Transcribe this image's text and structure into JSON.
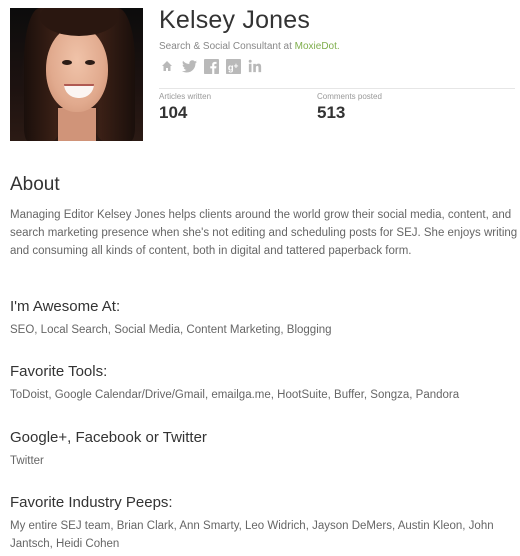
{
  "profile": {
    "name": "Kelsey Jones",
    "title_prefix": "Search & Social Consultant at ",
    "company": "MoxieDot."
  },
  "social_icons": [
    "home-icon",
    "twitter-icon",
    "facebook-icon",
    "google-plus-icon",
    "linkedin-icon"
  ],
  "stats": {
    "articles_label": "Articles written",
    "articles_value": "104",
    "comments_label": "Comments posted",
    "comments_value": "513"
  },
  "about": {
    "heading": "About",
    "text": "Managing Editor Kelsey Jones helps clients around the world grow their social media, content, and search marketing presence when she's not editing and scheduling posts for SEJ. She enjoys writing and consuming all kinds of content, both in digital and tattered paperback form."
  },
  "sections": [
    {
      "heading": "I'm Awesome At:",
      "text": "SEO, Local Search, Social Media, Content Marketing, Blogging"
    },
    {
      "heading": "Favorite Tools:",
      "text": "ToDoist, Google Calendar/Drive/Gmail, emailga.me, HootSuite, Buffer, Songza, Pandora"
    },
    {
      "heading": "Google+, Facebook or Twitter",
      "text": "Twitter"
    },
    {
      "heading": "Favorite Industry Peeps:",
      "text": "My entire SEJ team, Brian Clark, Ann Smarty, Leo Widrich, Jayson DeMers, Austin Kleon, John Jantsch, Heidi Cohen"
    }
  ],
  "colors": {
    "link_green": "#7fae4c",
    "icon_gray": "#b9b9b9",
    "heading": "#333333",
    "body": "#666666"
  }
}
